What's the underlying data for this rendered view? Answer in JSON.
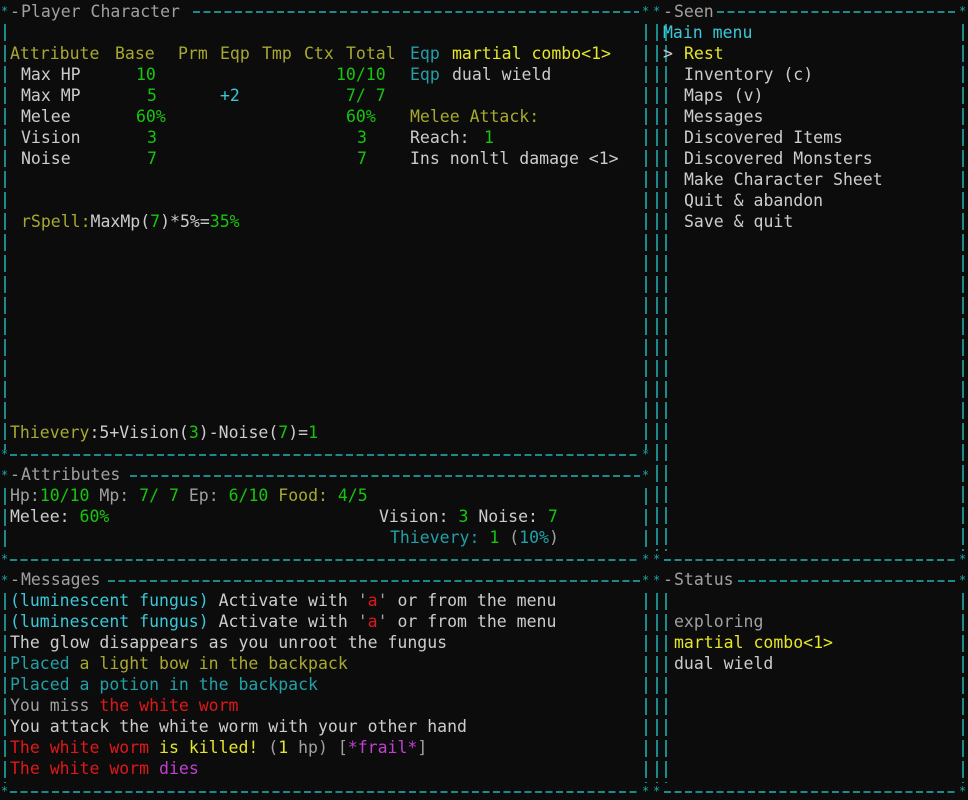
{
  "panels": {
    "player_character": {
      "title": "Player Character",
      "table_header": [
        "Attribute",
        "Base",
        "Prm",
        "Eqp",
        "Tmp",
        "Ctx",
        "Total"
      ],
      "rows": [
        {
          "name": "Max HP",
          "base": "10",
          "eqp": "",
          "total": "10/10"
        },
        {
          "name": "Max MP",
          "base": "5",
          "eqp": "+2",
          "total": "7/ 7"
        },
        {
          "name": "Melee",
          "base": "60%",
          "eqp": "",
          "total": "60%"
        },
        {
          "name": "Vision",
          "base": "3",
          "eqp": "",
          "total": "3"
        },
        {
          "name": "Noise",
          "base": "7",
          "eqp": "",
          "total": "7"
        }
      ],
      "equipment": [
        {
          "prefix": "Eqp",
          "name": "martial combo<1>"
        },
        {
          "prefix": "Eqp",
          "name": "dual wield"
        }
      ],
      "melee_attack": {
        "heading": "Melee Attack:",
        "reach_label": "Reach: ",
        "reach_value": "1",
        "effect": "Ins nonltl damage <1>"
      },
      "rspell": {
        "label": "rSpell",
        "sep": ":",
        "expr1": "MaxMp(",
        "arg": "7",
        "expr2": ")*5%=",
        "result": "35%"
      },
      "thievery": {
        "label": "Thievery",
        "sep": ":5+",
        "vision_label": "Vision",
        "paren_open1": "(",
        "vision_value": "3",
        "paren_close1": ")-",
        "noise_label": "Noise",
        "paren_open2": "(",
        "noise_value": "7",
        "paren_close2": ")=",
        "result": "1"
      }
    },
    "attributes": {
      "title": "Attributes",
      "hp_label": "Hp:",
      "hp_value": "10/10",
      "mp_label": " Mp: ",
      "mp_value": "7/ 7",
      "ep_label": " Ep: ",
      "ep_value": "6/10",
      "food_label": " Food: ",
      "food_value": "4/5",
      "melee_label": "Melee: ",
      "melee_value": "60%",
      "vision_label": "Vision: ",
      "vision_value": "3",
      "noise_label": " Noise: ",
      "noise_value": "7",
      "thievery_label": "Thievery: ",
      "thievery_value": "1",
      "thievery_pct_open": " (",
      "thievery_pct": "10%",
      "thievery_pct_close": ")"
    },
    "seen": {
      "title": "Seen",
      "menu_title": "Main menu",
      "cursor": ">",
      "items": [
        "Rest",
        "Inventory (c)",
        "Maps (v)",
        "Messages",
        "Discovered Items",
        "Discovered Monsters",
        "Make Character Sheet",
        "Quit & abandon",
        "Save & quit"
      ],
      "selected_index": 0
    },
    "messages": {
      "title": "Messages",
      "lines": [
        [
          {
            "t": "(luminescent fungus)",
            "c": "c"
          },
          {
            "t": " Activate with ",
            "c": "w"
          },
          {
            "t": "'",
            "c": "gr"
          },
          {
            "t": "a",
            "c": "r"
          },
          {
            "t": "'",
            "c": "gr"
          },
          {
            "t": " or from the menu",
            "c": "w"
          }
        ],
        [
          {
            "t": "(luminescent fungus)",
            "c": "c"
          },
          {
            "t": " Activate with ",
            "c": "w"
          },
          {
            "t": "'",
            "c": "gr"
          },
          {
            "t": "a",
            "c": "r"
          },
          {
            "t": "'",
            "c": "gr"
          },
          {
            "t": " or from the menu",
            "c": "w"
          }
        ],
        [
          {
            "t": "The glow disappears as you unroot the fungus",
            "c": "w"
          }
        ],
        [
          {
            "t": "Placed ",
            "c": "tc"
          },
          {
            "t": "a light bow in the backpack",
            "c": "o"
          }
        ],
        [
          {
            "t": "Placed a potion in the backpack",
            "c": "tc"
          }
        ],
        [
          {
            "t": "You miss ",
            "c": "gr"
          },
          {
            "t": "the white worm",
            "c": "r"
          }
        ],
        [
          {
            "t": "You attack the white worm with your other hand",
            "c": "w"
          }
        ],
        [
          {
            "t": "The white worm",
            "c": "r"
          },
          {
            "t": " is killed!",
            "c": "y"
          },
          {
            "t": " (",
            "c": "gr"
          },
          {
            "t": "1",
            "c": "y"
          },
          {
            "t": " hp) [",
            "c": "gr"
          },
          {
            "t": "*frail*",
            "c": "m"
          },
          {
            "t": "]",
            "c": "gr"
          }
        ],
        [
          {
            "t": "The white worm",
            "c": "r"
          },
          {
            "t": " dies",
            "c": "m"
          }
        ]
      ]
    },
    "status": {
      "title": "Status",
      "lines": [
        {
          "t": "exploring",
          "c": "gr"
        },
        {
          "t": "martial combo<1>",
          "c": "y"
        },
        {
          "t": "dual wield",
          "c": "w"
        }
      ]
    }
  },
  "colors": {
    "background": "#0c0c0c",
    "border": "#1a9a9a",
    "green": "#16c60c",
    "yellow": "#e5e52a",
    "olive": "#a8a830",
    "cyan": "#3ac8d8",
    "teal": "#22a0a8",
    "red": "#e01818",
    "magenta": "#c040d0",
    "white": "#cccccc",
    "gray": "#a0a0a0"
  }
}
